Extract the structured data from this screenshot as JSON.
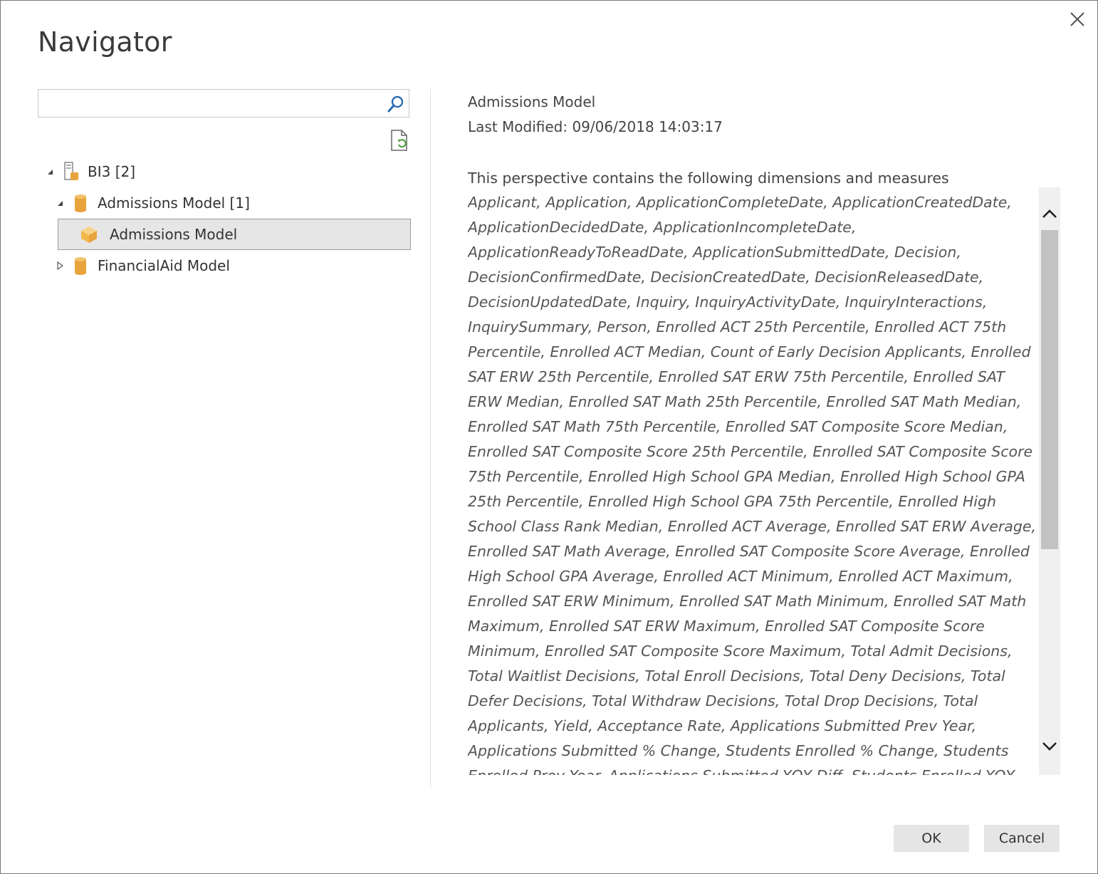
{
  "dialog": {
    "title": "Navigator",
    "ok_label": "OK",
    "cancel_label": "Cancel"
  },
  "search": {
    "value": "",
    "placeholder": ""
  },
  "tree": {
    "root": {
      "label": "BI3 [2]",
      "expanded": true
    },
    "admissions_model_db": {
      "label": "Admissions Model [1]",
      "expanded": true
    },
    "admissions_model_cube": {
      "label": "Admissions Model",
      "selected": true
    },
    "financialaid_model_db": {
      "label": "FinancialAid Model",
      "expanded": false
    }
  },
  "preview": {
    "name": "Admissions Model",
    "last_modified": "Last Modified: 09/06/2018 14:03:17",
    "heading": "This perspective contains the following dimensions and measures",
    "body": "Applicant, Application, ApplicationCompleteDate, ApplicationCreatedDate, ApplicationDecidedDate, ApplicationIncompleteDate, ApplicationReadyToReadDate, ApplicationSubmittedDate, Decision, DecisionConfirmedDate, DecisionCreatedDate, DecisionReleasedDate, DecisionUpdatedDate, Inquiry, InquiryActivityDate, InquiryInteractions, InquirySummary, Person, Enrolled ACT 25th Percentile, Enrolled ACT 75th Percentile, Enrolled ACT Median, Count of Early Decision Applicants, Enrolled SAT ERW 25th Percentile, Enrolled SAT ERW 75th Percentile, Enrolled SAT ERW Median, Enrolled SAT Math 25th Percentile, Enrolled SAT Math Median, Enrolled SAT Math 75th Percentile, Enrolled SAT Composite Score Median, Enrolled SAT Composite Score 25th Percentile, Enrolled SAT Composite Score 75th Percentile, Enrolled High School GPA Median, Enrolled High School GPA 25th Percentile, Enrolled High School GPA 75th Percentile, Enrolled High School Class Rank Median, Enrolled ACT Average, Enrolled SAT ERW Average, Enrolled SAT Math Average, Enrolled SAT Composite Score Average, Enrolled High School GPA Average, Enrolled ACT Minimum, Enrolled ACT Maximum, Enrolled SAT ERW Minimum, Enrolled SAT Math Minimum, Enrolled SAT Math Maximum, Enrolled SAT ERW Maximum, Enrolled SAT Composite Score Minimum, Enrolled SAT Composite Score Maximum, Total Admit Decisions, Total Waitlist Decisions, Total Enroll Decisions, Total Deny Decisions, Total Defer Decisions, Total Withdraw Decisions, Total Drop Decisions, Total Applicants, Yield, Acceptance Rate, Applications Submitted Prev Year, Applications Submitted % Change, Students Enrolled % Change, Students Enrolled Prev Year, Applications Submitted YOY Diff, Students Enrolled YOY Diff, Students Enrolled Running Total, Applications"
  },
  "scroll": {
    "position": 0.0,
    "visible_fraction": 0.55
  },
  "colors": {
    "db_icon": "#e8a33d",
    "cube_icon": "#f2b84b",
    "selected_bg": "#e6e6e6",
    "button_bg": "#e5e5e5"
  }
}
